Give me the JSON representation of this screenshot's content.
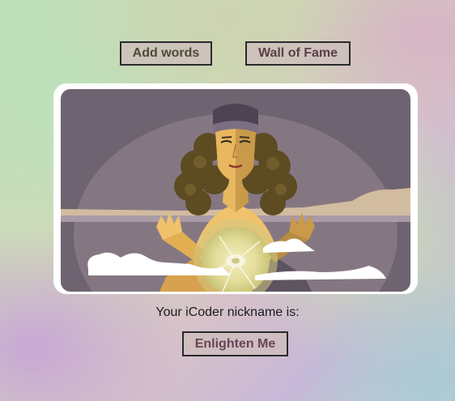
{
  "nav": {
    "add_words_label": "Add words",
    "wall_of_fame_label": "Wall of Fame"
  },
  "illustration": {
    "subject": "fortune-teller-crystal-ball"
  },
  "result": {
    "nickname_prompt": "Your iCoder nickname is:",
    "nickname_value": ""
  },
  "actions": {
    "enlighten_label": "Enlighten Me"
  },
  "colors": {
    "button_bg": "#cdbebc",
    "button_border": "#2a2a2a",
    "card_bg": "#ffffff",
    "scene_bg": "#6f6470",
    "hair": "#5c4c24",
    "skin": "#f1c873",
    "orb": "#d7d28a"
  }
}
